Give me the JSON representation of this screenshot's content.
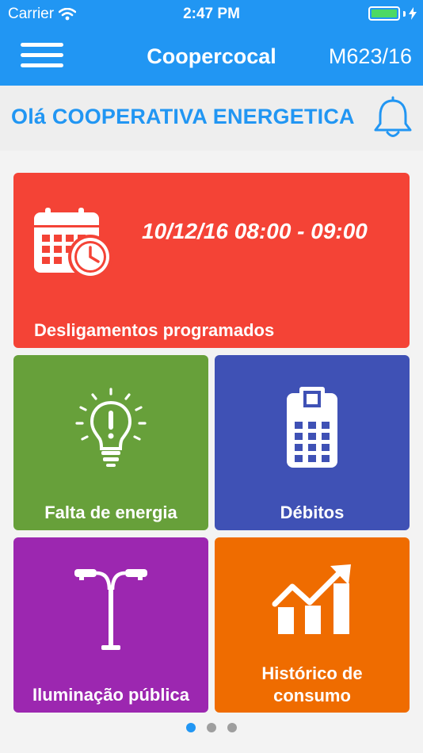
{
  "status_bar": {
    "carrier": "Carrier",
    "time": "2:47 PM",
    "battery_level": 1.0,
    "battery_color": "#4cd964"
  },
  "nav": {
    "title": "Coopercocal",
    "code": "M623/16",
    "menu_icon": "hamburger-icon"
  },
  "greeting": {
    "text": "Olá COOPERATIVA ENERGETICA COCAL",
    "bell_icon": "bell-icon"
  },
  "tiles": {
    "desligamentos": {
      "label": "Desligamentos programados",
      "date": "10/12/16 08:00 - 09:00",
      "icon": "calendar-clock-icon",
      "color": "#f44336"
    },
    "falta": {
      "label": "Falta de energia",
      "icon": "lightbulb-alert-icon",
      "color": "#67a03a"
    },
    "debitos": {
      "label": "Débitos",
      "icon": "calculator-icon",
      "color": "#3f51b5"
    },
    "iluminacao": {
      "label": "Iluminação pública",
      "icon": "street-lamp-icon",
      "color": "#9c27b0"
    },
    "historico": {
      "label_line1": "Histórico de",
      "label_line2": "consumo",
      "icon": "chart-growth-icon",
      "color": "#ef6c00"
    }
  },
  "pager": {
    "count": 3,
    "active_index": 0
  }
}
